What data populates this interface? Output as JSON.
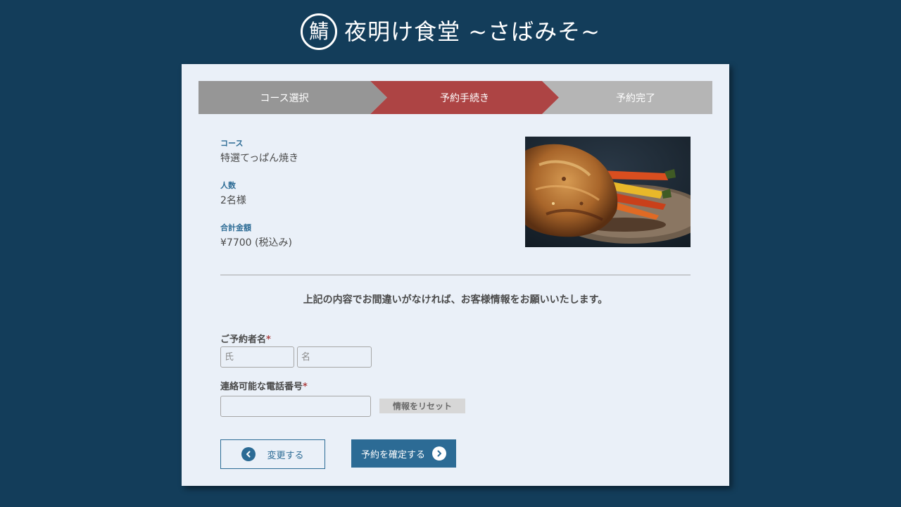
{
  "header": {
    "logo_char": "鯖",
    "title": "夜明け食堂 ~さばみそ~"
  },
  "steps": [
    {
      "label": "コース選択",
      "state": "done",
      "color": "#969696"
    },
    {
      "label": "予約手続き",
      "state": "current",
      "color": "#ad4444"
    },
    {
      "label": "予約完了",
      "state": "upcoming",
      "color": "#b5b5b5"
    }
  ],
  "summary": {
    "course_label": "コース",
    "course_value": "特選てっぱん焼き",
    "people_label": "人数",
    "people_value": "2名様",
    "total_label": "合計金額",
    "total_value": "¥7700 (税込み)"
  },
  "dish_image": {
    "icon": "roast-meat-with-carrots-photo"
  },
  "message": "上記の内容でお間違いがなければ、お客様情報をお願いいたします。",
  "form": {
    "name_label": "ご予約者名",
    "required_mark": "*",
    "last_name_placeholder": "氏",
    "first_name_placeholder": "名",
    "phone_label": "連絡可能な電話番号",
    "phone_value": "",
    "reset_label": "情報をリセット"
  },
  "actions": {
    "change_label": "変更する",
    "confirm_label": "予約を確定する"
  },
  "colors": {
    "background": "#133d5a",
    "card": "#eaf0f8",
    "accent": "#2c6b95",
    "active_step": "#ad4444"
  }
}
